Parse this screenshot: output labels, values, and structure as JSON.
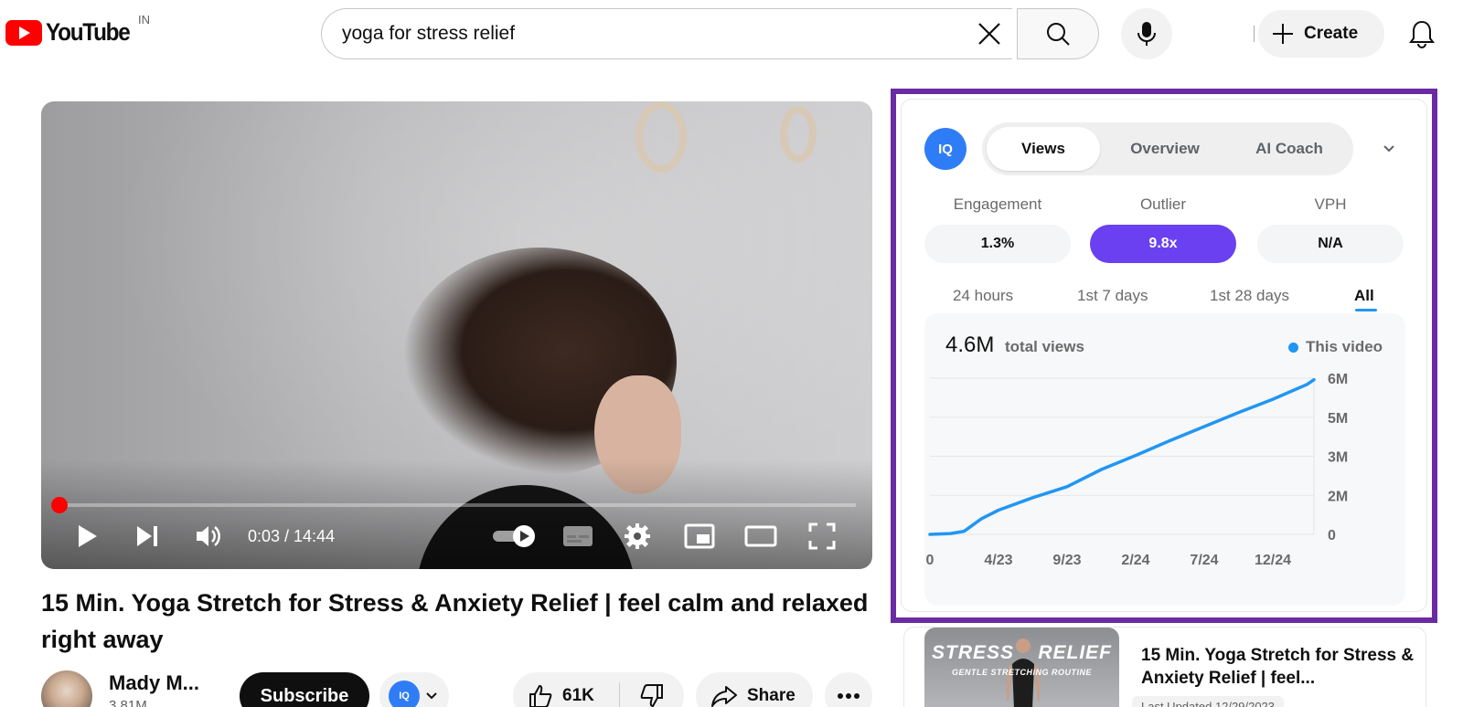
{
  "header": {
    "logo_text": "YouTube",
    "country_code": "IN",
    "search_value": "yoga for stress relief",
    "create_label": "Create"
  },
  "player": {
    "time_display": "0:03 / 14:44",
    "progress_fraction": 0.0034
  },
  "video": {
    "title": "15 Min. Yoga Stretch for Stress & Anxiety Relief | feel calm and relaxed right away",
    "channel_name": "Mady M...",
    "channel_subs": "3.81M",
    "subscribe_label": "Subscribe",
    "likes": "61K",
    "share_label": "Share"
  },
  "panel": {
    "logo_text": "IQ",
    "tabs": [
      {
        "label": "Views",
        "active": true
      },
      {
        "label": "Overview",
        "active": false
      },
      {
        "label": "AI Coach",
        "active": false
      }
    ],
    "metrics": [
      {
        "label": "Engagement",
        "value": "1.3%",
        "highlight": false
      },
      {
        "label": "Outlier",
        "value": "9.8x",
        "highlight": true
      },
      {
        "label": "VPH",
        "value": "N/A",
        "highlight": false
      }
    ],
    "ranges": [
      {
        "label": "24 hours",
        "active": false
      },
      {
        "label": "1st 7 days",
        "active": false
      },
      {
        "label": "1st 28 days",
        "active": false
      },
      {
        "label": "All",
        "active": true
      }
    ],
    "total_views_value": "4.6M",
    "total_views_label": "total views",
    "legend_label": "This video",
    "accent_color": "#2196f3",
    "highlight_color": "#6a40f0",
    "frame_color": "#6b2aa3"
  },
  "chart_data": {
    "type": "line",
    "x_tick_labels": [
      "0",
      "4/23",
      "9/23",
      "2/24",
      "7/24",
      "12/24"
    ],
    "y_tick_labels": [
      "0",
      "2M",
      "3M",
      "5M",
      "6M"
    ],
    "ylim": [
      0,
      6000000
    ],
    "series": [
      {
        "name": "This video",
        "x": [
          0,
          0.3,
          0.5,
          0.75,
          1.0,
          1.5,
          2.0,
          2.5,
          3.0,
          3.5,
          4.0,
          4.5,
          5.0,
          5.5,
          5.6
        ],
        "y": [
          0,
          0.02,
          0.08,
          0.4,
          0.62,
          0.94,
          1.22,
          1.66,
          2.02,
          2.4,
          2.76,
          3.12,
          3.46,
          3.84,
          3.96
        ]
      }
    ]
  },
  "related": {
    "thumb_word_left": "STRESS",
    "thumb_word_right": "RELIEF",
    "thumb_subtitle": "GENTLE STRETCHING ROUTINE",
    "title": "15 Min. Yoga Stretch for Stress & Anxiety Relief | feel...",
    "updated": "Last Updated 12/29/2023"
  }
}
